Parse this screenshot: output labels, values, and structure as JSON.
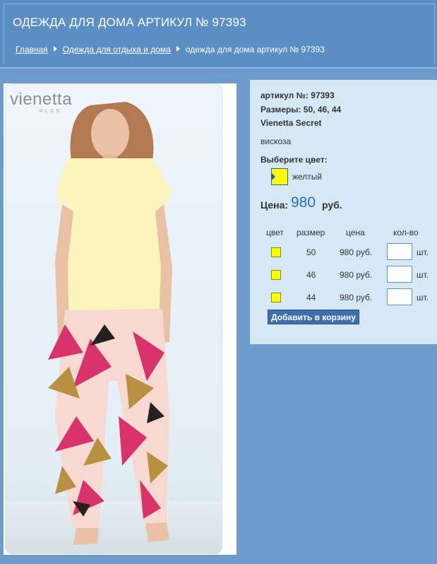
{
  "header": {
    "title": "ОДЕЖДА ДЛЯ ДОМА АРТИКУЛ № 97393",
    "breadcrumb": [
      "Главная",
      "Одежда для отдыха и дома",
      "одежда для дома артикул № 97393"
    ]
  },
  "product_image": {
    "logo_text": "vienetta",
    "logo_sub": "PLUS"
  },
  "product": {
    "article_line": "артикул №: 97393",
    "sizes_line": "Размеры: 50, 46, 44",
    "brand": "Vienetta Secret",
    "material": "вискоза",
    "choose_color_label": "Выберите цвет:",
    "color_name": "желтый",
    "price_label": "Цена:",
    "price_value": "980",
    "price_currency": "руб."
  },
  "table": {
    "headers": [
      "цвет",
      "размер",
      "цена",
      "кол-во"
    ],
    "rows": [
      {
        "size": "50",
        "price": "980 руб.",
        "unit": "шт."
      },
      {
        "size": "46",
        "price": "980 руб.",
        "unit": "шт."
      },
      {
        "size": "44",
        "price": "980 руб.",
        "unit": "шт."
      }
    ]
  },
  "add_to_cart_label": "Добавить в корзину",
  "colors": {
    "header_bg": "#5b8ec3",
    "page_bg": "#6d9ccb",
    "info_bg": "#d6e8f6",
    "swatch": "#ffff00",
    "price": "#2a6db5",
    "button": "#3e6faa"
  }
}
